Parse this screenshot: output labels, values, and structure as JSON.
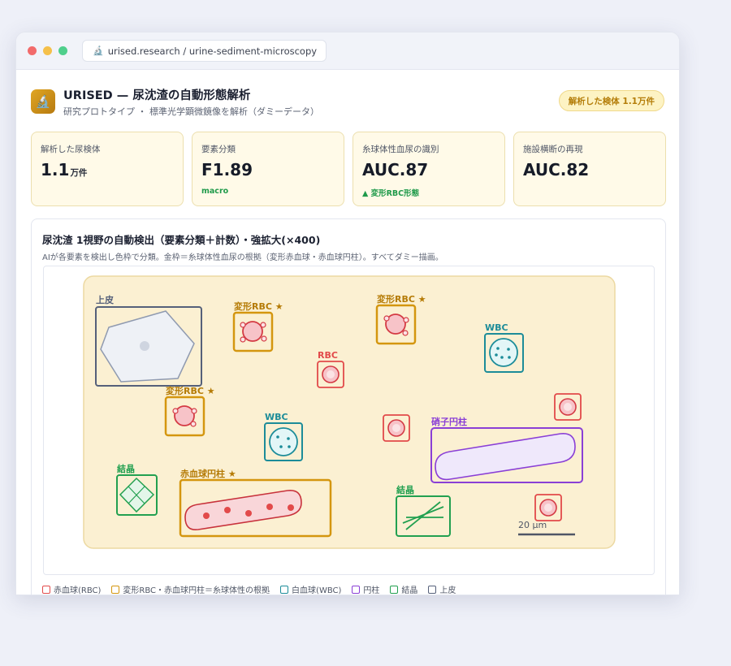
{
  "browser": {
    "url": "urised.research / urine-sediment-microscopy",
    "url_icon": "microscope-icon"
  },
  "app": {
    "title": "URISED — 尿沈渣の自動形態解析",
    "subtitle": "研究プロトタイプ ・ 標準光学顕微鏡像を解析（ダミーデータ）",
    "badge": "解析した検体 1.1万件",
    "logo_icon": "microscope-icon"
  },
  "metrics": [
    {
      "label": "解析した尿検体",
      "value": "1.1",
      "unit": "万件",
      "note": ""
    },
    {
      "label": "要素分類",
      "value": "F1.89",
      "unit": "",
      "note": "macro"
    },
    {
      "label": "糸球体性血尿の識別",
      "value": "AUC.87",
      "unit": "",
      "note": "▲ 変形RBC形態"
    },
    {
      "label": "施設横断の再現",
      "value": "AUC.82",
      "unit": "",
      "note": ""
    }
  ],
  "panel": {
    "title": "尿沈渣 1視野の自動検出（要素分類＋計数）・強拡大(×400)",
    "description": "AIが各要素を検出し色枠で分類。金枠＝糸球体性血尿の根拠（変形赤血球・赤血球円柱）。すべてダミー描画。"
  },
  "detections": {
    "epithelial": "上皮",
    "dysmorphic_rbc": "変形RBC ★",
    "rbc": "RBC",
    "wbc": "WBC",
    "hyaline_cast": "硝子円柱",
    "crystal": "結晶",
    "rbc_cast": "赤血球円柱 ★",
    "scale_bar": "20 µm"
  },
  "legend": [
    {
      "label": "赤血球(RBC)",
      "color": "#e24a4a"
    },
    {
      "label": "変形RBC・赤血球円柱＝糸球体性の根拠",
      "color": "#d4960f"
    },
    {
      "label": "白血球(WBC)",
      "color": "#1c8c99"
    },
    {
      "label": "円柱",
      "color": "#8a3fd6"
    },
    {
      "label": "結晶",
      "color": "#22a050"
    },
    {
      "label": "上皮",
      "color": "#55607a"
    }
  ],
  "colors": {
    "rbc": "#e24a4a",
    "dysmorphic": "#d4960f",
    "wbc": "#1c8c99",
    "cast": "#8a3fd6",
    "crystal": "#22a050",
    "epithelial": "#55607a",
    "field": "#fbf0d2"
  }
}
